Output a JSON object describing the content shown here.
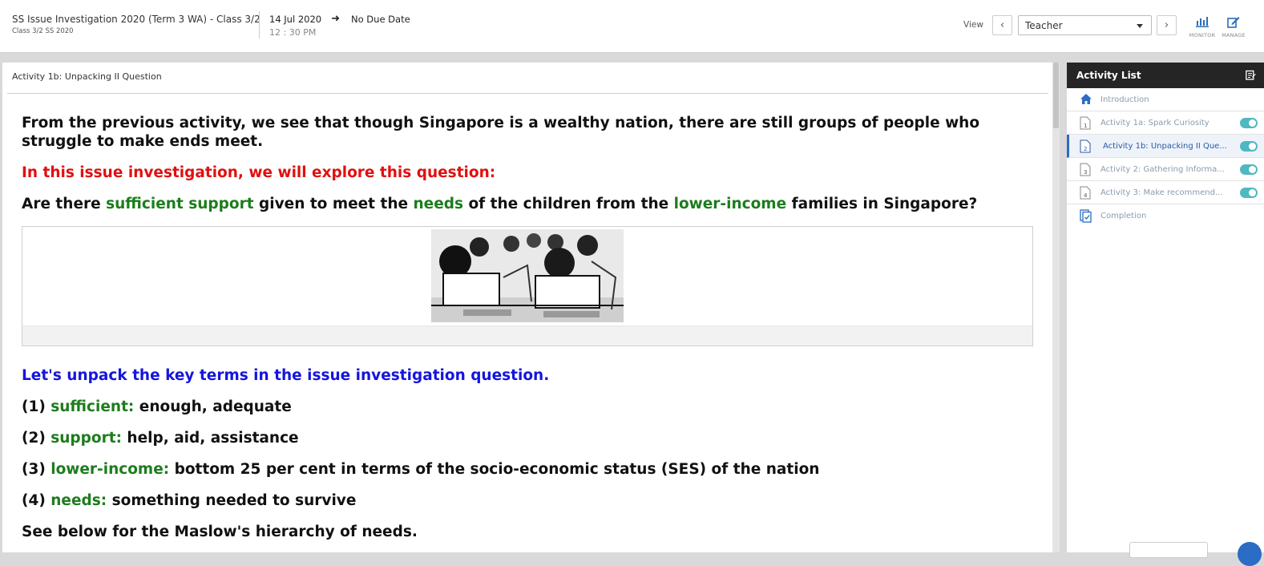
{
  "header": {
    "title": "SS Issue Investigation 2020 (Term 3 WA) - Class 3/2",
    "subtitle": "Class 3/2 SS 2020",
    "start_date": "14 Jul 2020",
    "start_time": "12 : 30 PM",
    "due": "No Due Date",
    "view_label": "View",
    "view_selected": "Teacher",
    "monitor_label": "MONITOR",
    "manage_label": "MANAGE"
  },
  "main": {
    "breadcrumb": "Activity 1b: Unpacking II Question",
    "intro": "From the previous activity, we see that though Singapore is a wealthy nation, there are still groups of people who struggle to make ends meet.",
    "question_intro": "In this issue investigation, we will explore this question:",
    "question": {
      "p1": "Are there ",
      "k1": "sufficient support",
      "p2": " given to meet the ",
      "k2": "needs",
      "p3": " of the children from the ",
      "k3": "lower-income",
      "p4": " families in Singapore?"
    },
    "unpack_heading": "Let's unpack the key terms in the issue investigation question.",
    "terms": [
      {
        "num": "(1) ",
        "term": "sufficient:",
        "def": " enough, adequate"
      },
      {
        "num": "(2) ",
        "term": "support:",
        "def": " help, aid, assistance"
      },
      {
        "num": "(3) ",
        "term": "lower-income:",
        "def": " bottom 25 per cent in terms of the socio-economic status (SES) of the nation"
      },
      {
        "num": "(4) ",
        "term": "needs:",
        "def": " something needed to survive"
      }
    ],
    "maslow_line": "See below for the Maslow's hierarchy of needs."
  },
  "sidebar": {
    "title": "Activity List",
    "items": [
      {
        "label": "Introduction",
        "icon": "home-icon"
      },
      {
        "label": "Activity 1a: Spark Curiosity",
        "num": "1"
      },
      {
        "label": "Activity 1b: Unpacking II Que...",
        "num": "2"
      },
      {
        "label": "Activity 2: Gathering Informa...",
        "num": "3"
      },
      {
        "label": "Activity 3: Make recommend...",
        "num": "4"
      },
      {
        "label": "Completion",
        "icon": "completion-icon"
      }
    ]
  },
  "colors": {
    "accent_blue": "#2b6cc4",
    "keyword_green": "#1c7d1c",
    "heading_red": "#e01010",
    "heading_blue": "#1515dd",
    "toggle_teal": "#4fb8c2"
  }
}
